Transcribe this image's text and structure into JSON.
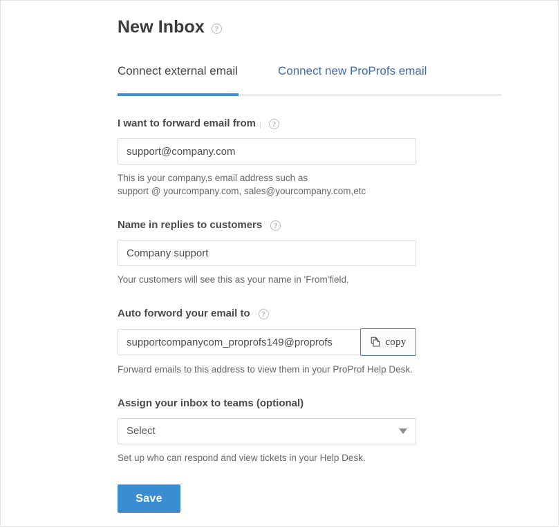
{
  "page": {
    "title": "New Inbox",
    "title_help_icon": "help-circle-icon"
  },
  "tabs": [
    {
      "label": "Connect external email",
      "active": true
    },
    {
      "label": "Connect new ProProfs email",
      "active": false
    }
  ],
  "form": {
    "forward_from": {
      "label": "I want to forward email from",
      "help_icon": "help-circle-icon",
      "value": "support@company.com",
      "placeholder": "support@company.com",
      "helper_line_1": "This is your company,s email address such as",
      "helper_line_2": "support @ yourcompany.com, sales@yourcompany.com,etc"
    },
    "reply_name": {
      "label": "Name in replies to customers",
      "help_icon": "help-circle-icon",
      "value": "Company support",
      "placeholder": "Company support",
      "helper": "Your customers will see this as your name in 'From'field."
    },
    "auto_forward": {
      "label": "Auto forword your email to",
      "help_icon": "help-circle-icon",
      "value": "supportcompanycom_proprofs149@proprofs",
      "placeholder": "supportcompanycom_proprofs149@proprofs",
      "copy_button_label": "copy",
      "copy_button_icon": "copy-pages-icon",
      "helper": "Forward emails to this address to view them in your ProProf Help Desk."
    },
    "assign_teams": {
      "label": "Assign your inbox to teams (optional)",
      "selected": "Select",
      "dropdown_icon": "chevron-down-icon",
      "helper": "Set up who can respond and view tickets in your Help Desk."
    },
    "save_label": "Save"
  },
  "colors": {
    "accent_blue": "#3b8dd1",
    "link_blue": "#3c6bb0",
    "copy_border_blue": "#4a86c8",
    "text_dark": "#3b3b3b",
    "helper_gray": "#666666",
    "border_gray": "#dcdcdc"
  }
}
